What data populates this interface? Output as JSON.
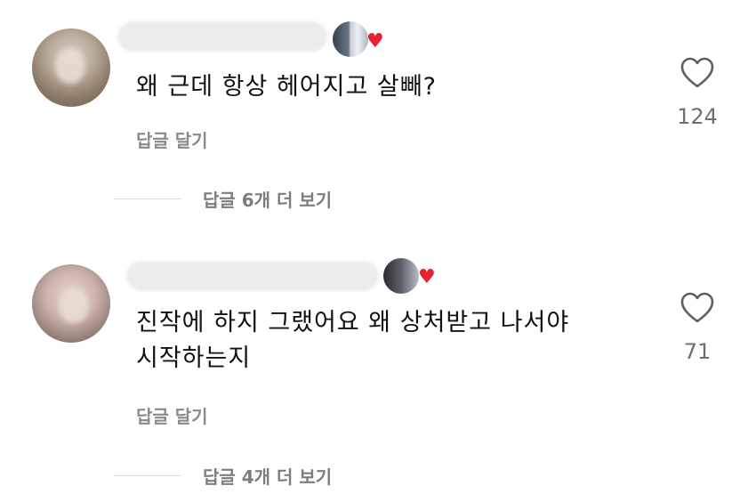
{
  "comments": [
    {
      "text_lines": [
        "왜 근데 항상 헤어지고 살빼?"
      ],
      "reply_label": "답글 달기",
      "likes": "124",
      "more_replies": "답글 6개 더 보기",
      "heart_icon": "heart-outline-icon",
      "author_liked_icon": "red-heart-icon"
    },
    {
      "text_lines": [
        "진작에 하지 그랬어요 왜 상처받고 나서야",
        "시작하는지"
      ],
      "reply_label": "답글 달기",
      "likes": "71",
      "more_replies": "답글 4개 더 보기",
      "heart_icon": "heart-outline-icon",
      "author_liked_icon": "red-heart-icon"
    }
  ],
  "colors": {
    "text": "#111111",
    "secondary": "#8a8a8a",
    "author_heart": "#e8212e"
  }
}
